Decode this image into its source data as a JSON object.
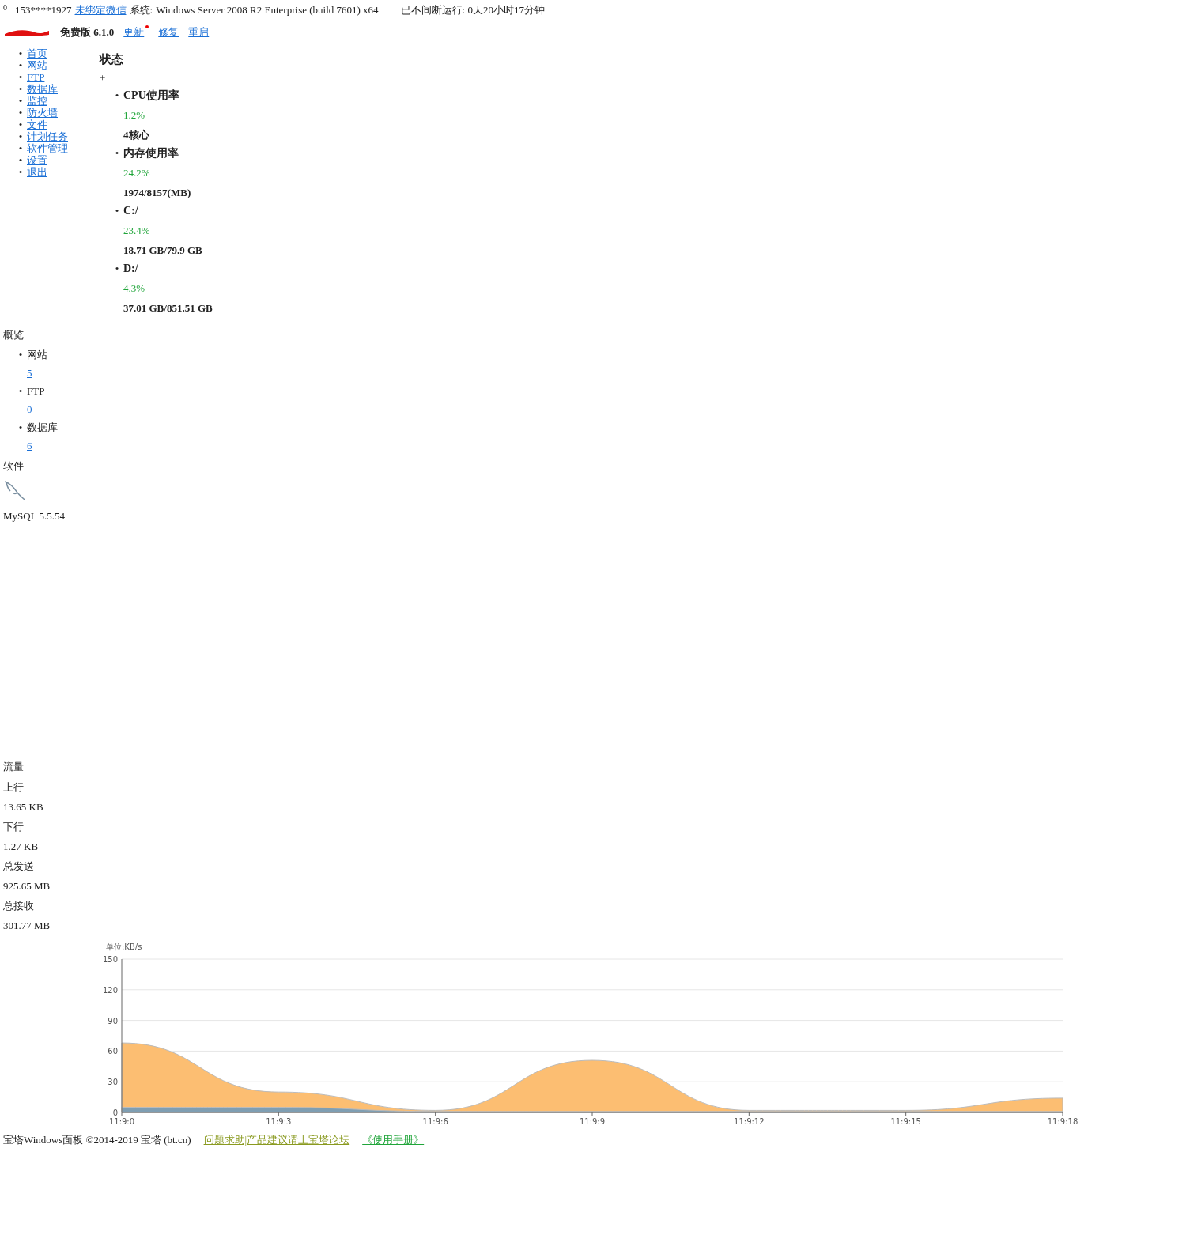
{
  "header": {
    "badge": "0",
    "account": "153****1927",
    "wechat_link": "未绑定微信",
    "system_label": "系统:",
    "system": "Windows Server 2008 R2 Enterprise (build 7601) x64",
    "uptime": "已不间断运行: 0天20小时17分钟"
  },
  "version": {
    "edition": "免费版 6.1.0",
    "actions": [
      {
        "label": "更新",
        "notify": true
      },
      {
        "label": "修复",
        "notify": false
      },
      {
        "label": "重启",
        "notify": false
      }
    ]
  },
  "bullet": "•",
  "nav": [
    "首页",
    "网站",
    "FTP",
    "数据库",
    "监控",
    "防火墙",
    "文件",
    "计划任务",
    "软件管理",
    "设置",
    "退出"
  ],
  "status": {
    "title": "状态",
    "marker": "+",
    "meters": [
      {
        "title": "CPU使用率",
        "value": "1.2%",
        "detail": "4核心"
      },
      {
        "title": "内存使用率",
        "value": "24.2%",
        "detail": "1974/8157(MB)"
      },
      {
        "title": "C:/",
        "value": "23.4%",
        "detail": "18.71 GB/79.9 GB"
      },
      {
        "title": "D:/",
        "value": "4.3%",
        "detail": "37.01 GB/851.51 GB"
      }
    ]
  },
  "overview": {
    "title": "概览",
    "items": [
      {
        "label": "网站",
        "count": "5"
      },
      {
        "label": "FTP",
        "count": "0"
      },
      {
        "label": "数据库",
        "count": "6"
      }
    ]
  },
  "software": {
    "title": "软件",
    "items": [
      {
        "name": "MySQL 5.5.54"
      }
    ]
  },
  "traffic": {
    "title": "流量",
    "stats": [
      {
        "label": "上行",
        "value": "13.65 KB"
      },
      {
        "label": "下行",
        "value": "1.27 KB"
      },
      {
        "label": "总发送",
        "value": "925.65 MB"
      },
      {
        "label": "总接收",
        "value": "301.77 MB"
      }
    ],
    "chart_data": {
      "type": "area",
      "grid": true,
      "ylabel": "单位:KB/s",
      "categories": [
        "11:9:0",
        "11:9:3",
        "11:9:6",
        "11:9:9",
        "11:9:12",
        "11:9:15",
        "11:9:18"
      ],
      "ylim": [
        0,
        150
      ],
      "yticks": [
        0,
        30,
        60,
        90,
        120,
        150
      ],
      "series": [
        {
          "color": "#fcbe72",
          "values": [
            68,
            20,
            2,
            51,
            2,
            2,
            14
          ]
        },
        {
          "color": "#7f9eb2",
          "values": [
            5,
            5,
            1,
            1,
            1,
            1,
            1
          ]
        }
      ]
    }
  },
  "footer": {
    "copyright": "宝塔Windows面板 ©2014-2019 宝塔 (bt.cn)",
    "links": [
      "问题求助|产品建议请上宝塔论坛",
      "《使用手册》"
    ]
  }
}
